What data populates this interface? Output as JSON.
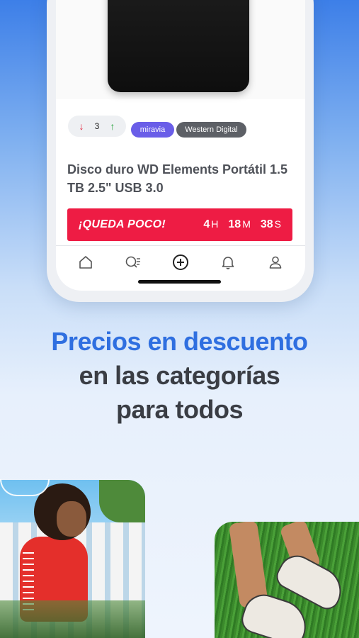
{
  "product": {
    "vote_count": "3",
    "tags": [
      "miravia",
      "Western Digital"
    ],
    "title": "Disco duro WD Elements Portátil 1.5 TB 2.5\" USB 3.0"
  },
  "deal": {
    "label": "¡QUEDA POCO!",
    "hours": "4",
    "hours_unit": "H",
    "minutes": "18",
    "minutes_unit": "M",
    "seconds": "38",
    "seconds_unit": "S"
  },
  "tabbar": {
    "icons": [
      "home-icon",
      "search-icon",
      "add-icon",
      "bell-icon",
      "profile-icon"
    ]
  },
  "headline": {
    "line1": "Precios en descuento",
    "line2": "en las categorías",
    "line3": "para todos"
  },
  "colors": {
    "accent_blue": "#2f6fe0",
    "deal_red": "#ee1c44",
    "tag_miravia": "#6a5ee8",
    "tag_brand": "#5d6066"
  }
}
